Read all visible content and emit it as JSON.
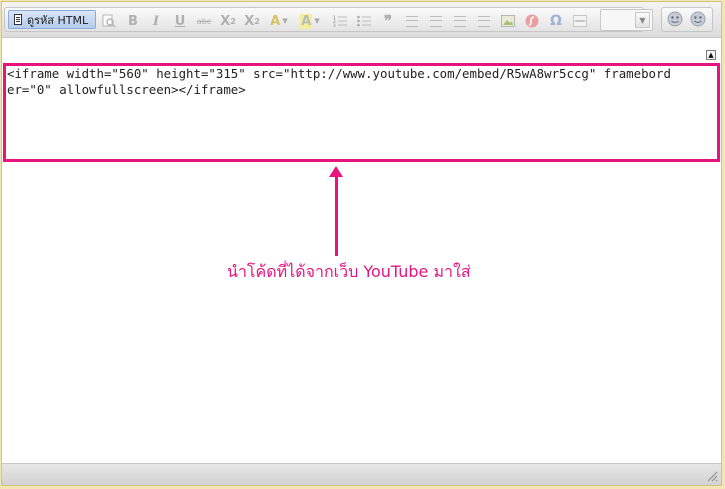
{
  "toolbar": {
    "source_label": "ดูรหัส HTML",
    "subscript_base": "X",
    "subscript_mark": "2",
    "superscript_base": "X",
    "superscript_mark": "2",
    "format_combo_value": ""
  },
  "editor": {
    "code_lines": [
      "<iframe width=\"560\" height=\"315\" src=\"http://www.youtube.com/embed/R5wA8wr5ccg\" framebord",
      "er=\"0\" allowfullscreen></iframe>"
    ]
  },
  "annotation": {
    "text": "นำโค้ดที่ได้จากเว็บ YouTube มาใส่",
    "color": "#e5147f"
  },
  "colors": {
    "highlight": "#e5147f",
    "toolbar_bg": "#e4e4e4",
    "outer_bg": "#f3e6b5"
  },
  "icons": [
    "document-icon",
    "preview-icon",
    "bold-icon",
    "italic-icon",
    "underline-icon",
    "strikethrough-icon",
    "subscript-icon",
    "superscript-icon",
    "text-color-icon",
    "background-color-icon",
    "numbered-list-icon",
    "bulleted-list-icon",
    "blockquote-icon",
    "align-left-icon",
    "align-center-icon",
    "align-right-icon",
    "justify-icon",
    "image-icon",
    "flash-icon",
    "special-char-icon",
    "horizontal-rule-icon",
    "smiley-icon"
  ]
}
